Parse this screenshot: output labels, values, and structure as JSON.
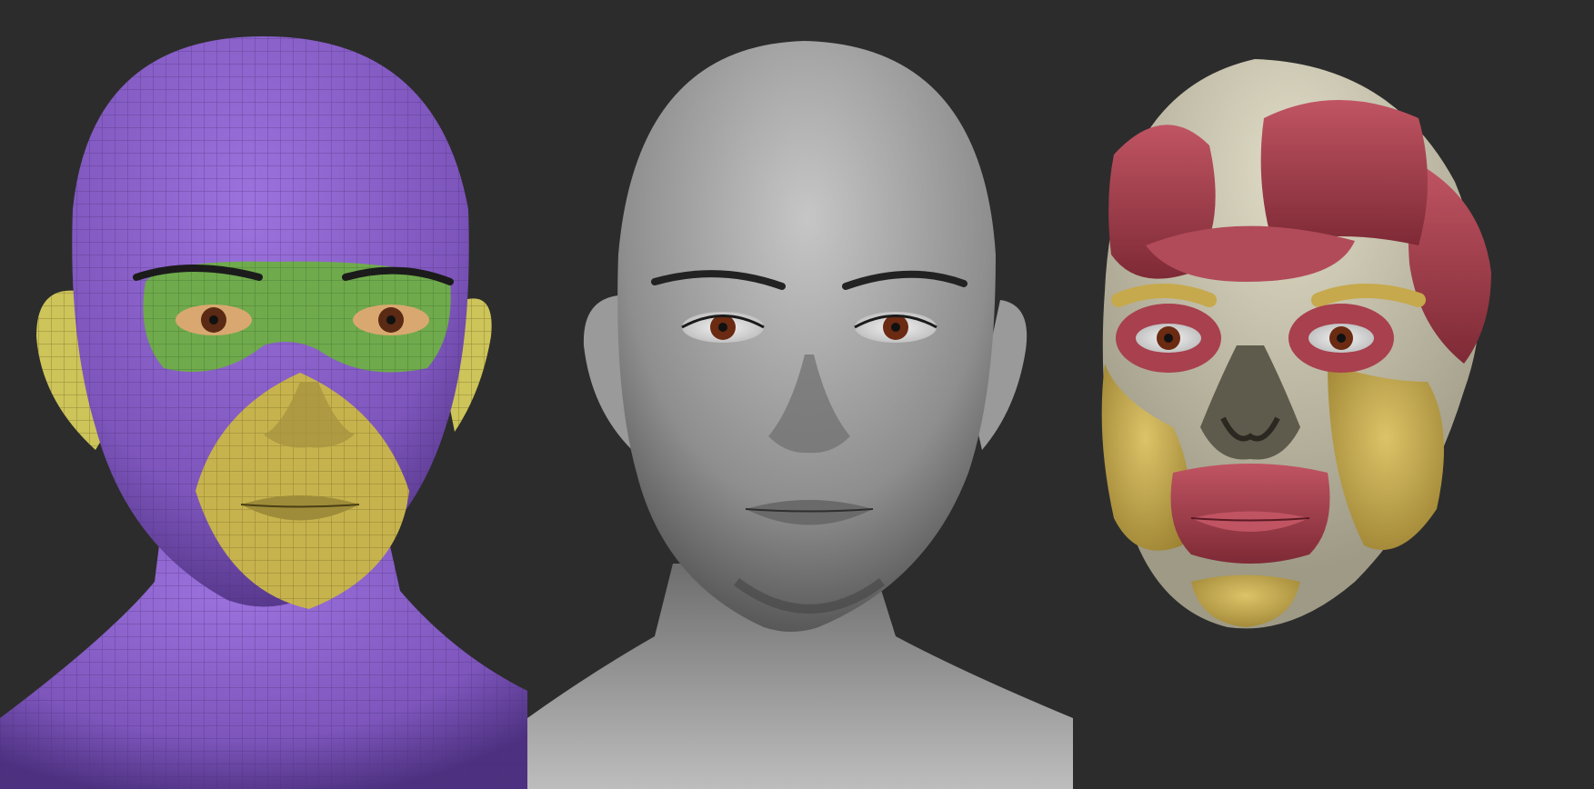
{
  "scene": {
    "background": "#2c2c2c",
    "panels": [
      {
        "id": "topology",
        "colors": {
          "skin": "#8a5fc7",
          "wireframe": "#5b3c8f",
          "eye_zone": "#6fae4f",
          "mouth_zone": "#c3b04a",
          "ear": "#cfc85a"
        }
      },
      {
        "id": "sculpt",
        "colors": {
          "clay": "#8f8f8f",
          "clay_light": "#b8b8b8",
          "clay_dark": "#5a5a5a",
          "iris": "#6b2a12"
        }
      },
      {
        "id": "anatomy",
        "colors": {
          "skull": "#cfcab2",
          "muscle": "#a8404d",
          "muscle_dark": "#7a2632",
          "fat": "#c6a94c",
          "bone": "#6f6a5a"
        }
      }
    ]
  }
}
